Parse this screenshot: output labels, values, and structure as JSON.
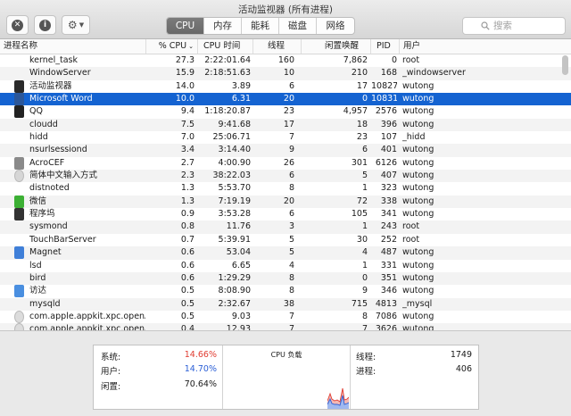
{
  "window": {
    "title": "活动监视器 (所有进程)"
  },
  "toolbar": {
    "tabs": [
      "CPU",
      "内存",
      "能耗",
      "磁盘",
      "网络"
    ],
    "active_tab": "CPU",
    "search_placeholder": "搜索"
  },
  "columns": [
    "进程名称",
    "% CPU",
    "CPU 时间",
    "线程",
    "闲置唤醒",
    "PID",
    "用户"
  ],
  "sort": {
    "column": "% CPU",
    "direction": "descending"
  },
  "processes": [
    [
      "kernel_task",
      "27.3",
      "2:22:01.64",
      "160",
      "7,862",
      "0",
      "root"
    ],
    [
      "WindowServer",
      "15.9",
      "2:18:51.63",
      "10",
      "210",
      "168",
      "_windowserver"
    ],
    [
      "活动监视器",
      "14.0",
      "3.89",
      "6",
      "17",
      "10827",
      "wutong"
    ],
    [
      "Microsoft Word",
      "10.0",
      "6.31",
      "20",
      "0",
      "10831",
      "wutong"
    ],
    [
      "QQ",
      "9.4",
      "1:18:20.87",
      "23",
      "4,957",
      "2576",
      "wutong"
    ],
    [
      "cloudd",
      "7.5",
      "9:41.68",
      "17",
      "18",
      "396",
      "wutong"
    ],
    [
      "hidd",
      "7.0",
      "25:06.71",
      "7",
      "23",
      "107",
      "_hidd"
    ],
    [
      "nsurlsessiond",
      "3.4",
      "3:14.40",
      "9",
      "6",
      "401",
      "wutong"
    ],
    [
      "AcroCEF",
      "2.7",
      "4:00.90",
      "26",
      "301",
      "6126",
      "wutong"
    ],
    [
      "简体中文输入方式",
      "2.3",
      "38:22.03",
      "6",
      "5",
      "407",
      "wutong"
    ],
    [
      "distnoted",
      "1.3",
      "5:53.70",
      "8",
      "1",
      "323",
      "wutong"
    ],
    [
      "微信",
      "1.3",
      "7:19.19",
      "20",
      "72",
      "338",
      "wutong"
    ],
    [
      "程序坞",
      "0.9",
      "3:53.28",
      "6",
      "105",
      "341",
      "wutong"
    ],
    [
      "sysmond",
      "0.8",
      "11.76",
      "3",
      "1",
      "243",
      "root"
    ],
    [
      "TouchBarServer",
      "0.7",
      "5:39.91",
      "5",
      "30",
      "252",
      "root"
    ],
    [
      "Magnet",
      "0.6",
      "53.04",
      "5",
      "4",
      "487",
      "wutong"
    ],
    [
      "lsd",
      "0.6",
      "6.65",
      "4",
      "1",
      "331",
      "wutong"
    ],
    [
      "bird",
      "0.6",
      "1:29.29",
      "8",
      "0",
      "351",
      "wutong"
    ],
    [
      "访达",
      "0.5",
      "8:08.90",
      "8",
      "9",
      "346",
      "wutong"
    ],
    [
      "mysqld",
      "0.5",
      "2:32.67",
      "38",
      "715",
      "4813",
      "_mysql"
    ],
    [
      "com.apple.appkit.xpc.openA...",
      "0.5",
      "9.03",
      "7",
      "8",
      "7086",
      "wutong"
    ],
    [
      "com.apple.appkit.xpc.openA...",
      "0.4",
      "12.93",
      "7",
      "7",
      "3626",
      "wutong"
    ]
  ],
  "selected_row": 3,
  "icons": [
    "",
    "",
    "activity-monitor-icon",
    "word-icon",
    "qq-icon",
    "",
    "",
    "",
    "acrocef-icon",
    "input-method-icon",
    "",
    "wechat-icon",
    "dock-icon",
    "",
    "",
    "magnet-icon",
    "",
    "",
    "finder-icon",
    "",
    "app-icon",
    "app-icon"
  ],
  "stats": {
    "system_label": "系统:",
    "system_value": "14.66%",
    "user_label": "用户:",
    "user_value": "14.70%",
    "idle_label": "闲置:",
    "idle_value": "70.64%",
    "cpu_load_label": "CPU 负载",
    "threads_label": "线程:",
    "threads_value": "1749",
    "processes_label": "进程:",
    "processes_value": "406"
  },
  "colors": {
    "system": "#e03c31",
    "user": "#2b5fd6",
    "selection": "#1463d1"
  }
}
